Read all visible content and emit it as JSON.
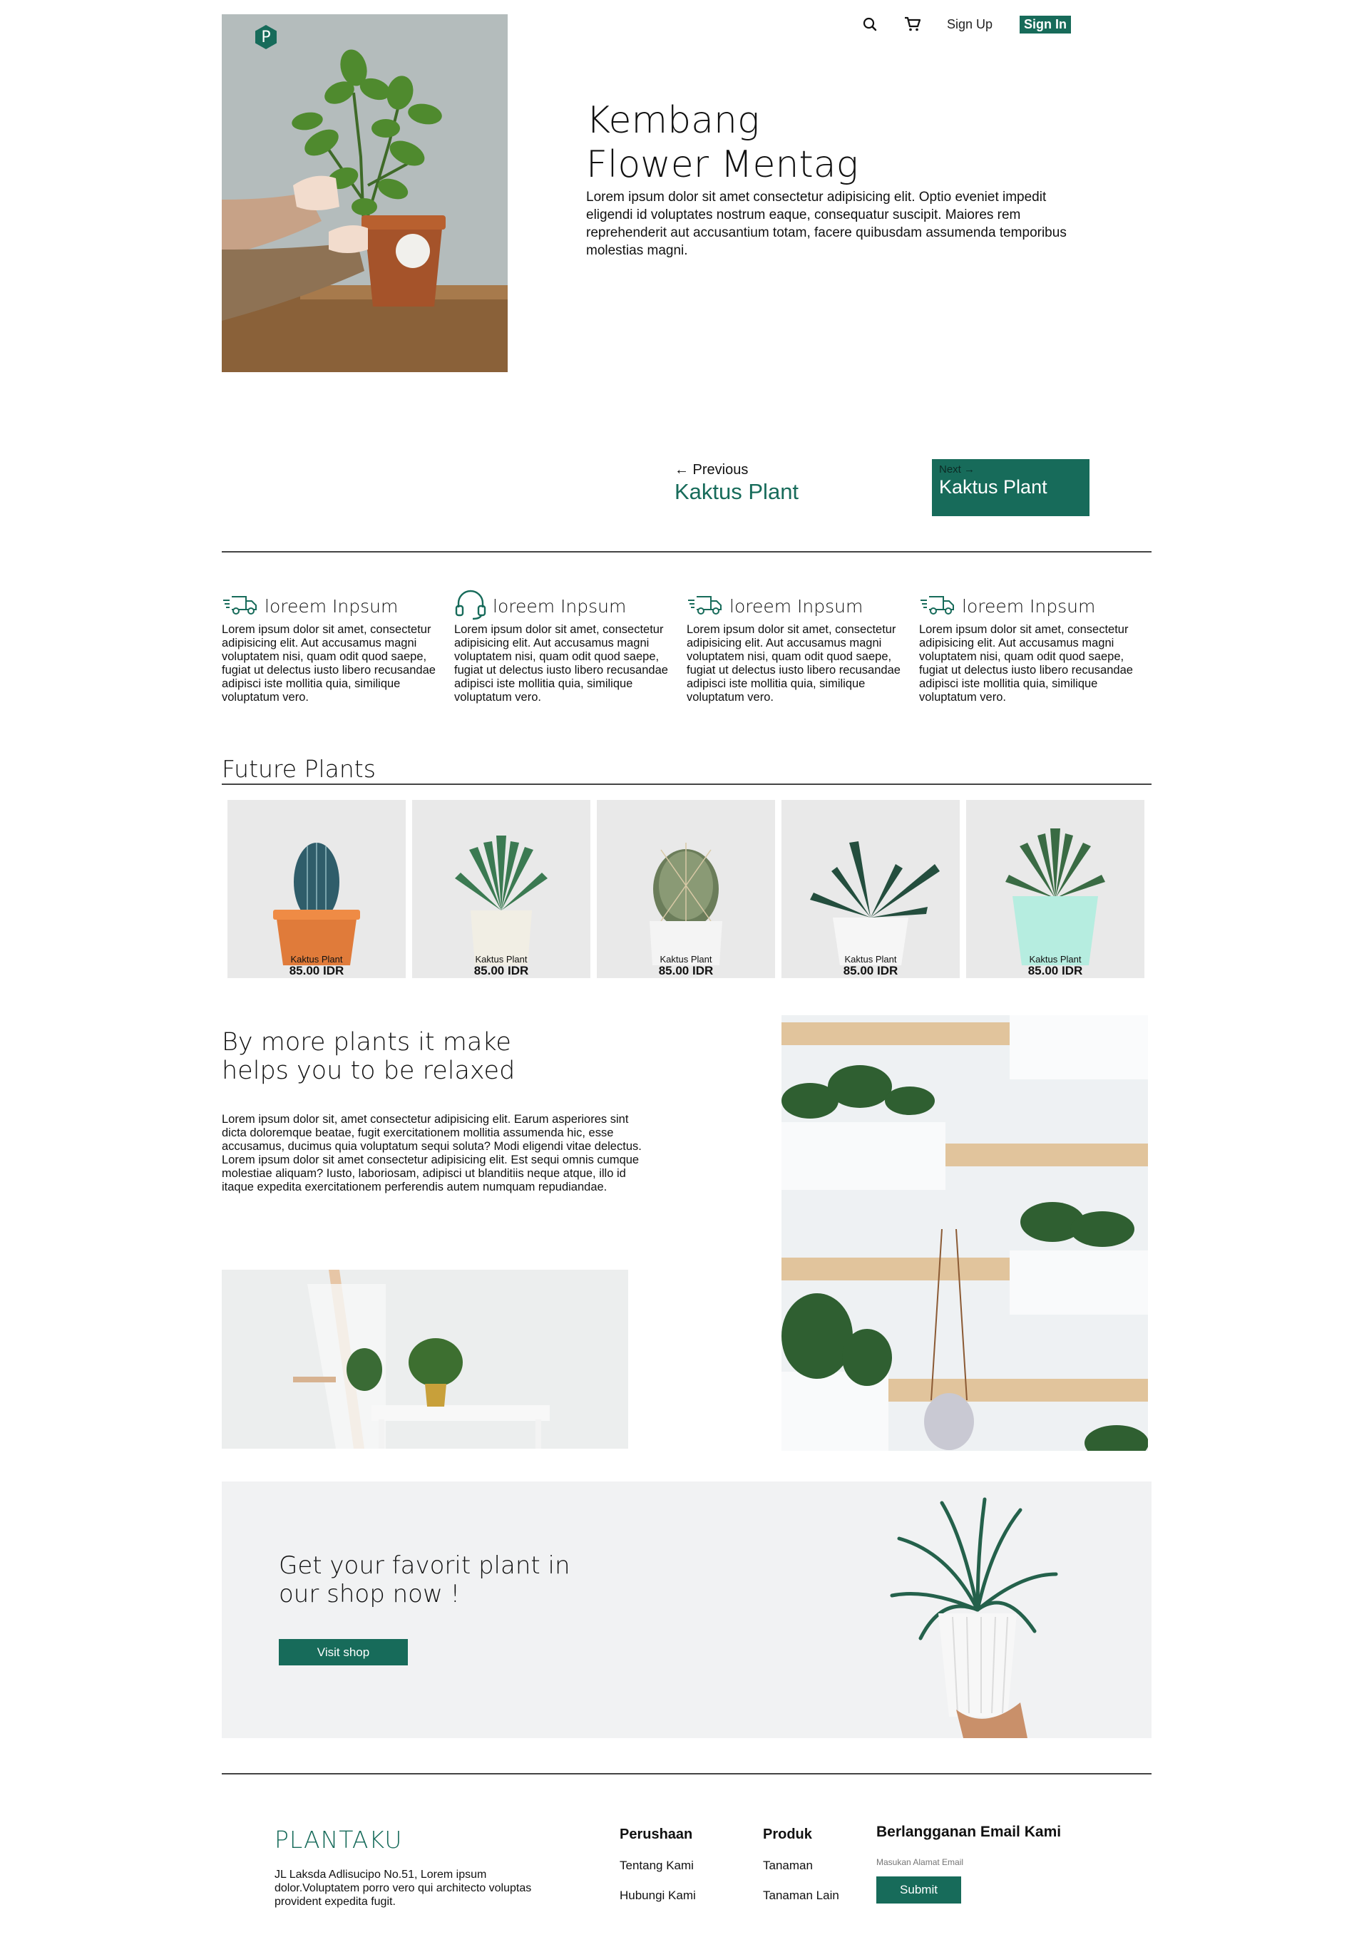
{
  "header": {
    "logo_letter": "P",
    "signup_label": "Sign Up",
    "signin_label": "Sign In"
  },
  "hero": {
    "title_line1": "Kembang",
    "title_line2": "Flower Mentag",
    "description": "Lorem ipsum dolor sit amet consectetur adipisicing elit. Optio eveniet impedit eligendi id voluptates nostrum eaque, consequatur suscipit. Maiores rem reprehenderit aut accusantium totam, facere quibusdam assumenda temporibus molestias magni."
  },
  "pager": {
    "prev_label": "← Previous",
    "prev_name": "Kaktus Plant",
    "next_label": "Next →",
    "next_name": "Kaktus Plant"
  },
  "features": [
    {
      "icon": "truck-icon",
      "title": "loreem Inpsum",
      "text": "Lorem ipsum dolor sit amet, consectetur adipisicing elit. Aut accusamus magni voluptatem nisi, quam odit quod saepe, fugiat ut delectus iusto libero recusandae adipisci iste mollitia quia, similique voluptatum vero."
    },
    {
      "icon": "headset-icon",
      "title": "loreem Inpsum",
      "text": "Lorem ipsum dolor sit amet, consectetur adipisicing elit. Aut accusamus magni voluptatem nisi, quam odit quod saepe, fugiat ut delectus iusto libero recusandae adipisci iste mollitia quia, similique voluptatum vero."
    },
    {
      "icon": "truck-icon",
      "title": "loreem Inpsum",
      "text": "Lorem ipsum dolor sit amet, consectetur adipisicing elit. Aut accusamus magni voluptatem nisi, quam odit quod saepe, fugiat ut delectus iusto libero recusandae adipisci iste mollitia quia, similique voluptatum vero."
    },
    {
      "icon": "truck-icon",
      "title": "loreem Inpsum",
      "text": "Lorem ipsum dolor sit amet, consectetur adipisicing elit. Aut accusamus magni voluptatem nisi, quam odit quod saepe, fugiat ut delectus iusto libero recusandae adipisci iste mollitia quia, similique voluptatum vero."
    }
  ],
  "future_plants": {
    "title": "Future Plants",
    "items": [
      {
        "name": "Kaktus Plant",
        "price": "85.00 IDR"
      },
      {
        "name": "Kaktus Plant",
        "price": "85.00 IDR"
      },
      {
        "name": "Kaktus Plant",
        "price": "85.00 IDR"
      },
      {
        "name": "Kaktus Plant",
        "price": "85.00 IDR"
      },
      {
        "name": "Kaktus Plant",
        "price": "85.00 IDR"
      }
    ]
  },
  "relax": {
    "title_line1": "By more plants it make",
    "title_line2": "helps you to be relaxed",
    "text": "Lorem ipsum dolor sit, amet consectetur adipisicing elit. Earum asperiores sint dicta doloremque beatae, fugit exercitationem mollitia assumenda hic, esse accusamus, ducimus quia voluptatum sequi soluta? Modi eligendi vitae delectus. Lorem ipsum dolor sit amet consectetur adipisicing elit. Est sequi omnis cumque molestiae aliquam? Iusto, laboriosam, adipisci ut blanditiis neque atque, illo id itaque expedita exercitationem perferendis autem numquam repudiandae."
  },
  "cta": {
    "title_line1": "Get your favorit plant in",
    "title_line2": "our shop now !",
    "button": "Visit shop"
  },
  "footer": {
    "brand": "PLANTAKU",
    "address": "JL Laksda Adlisucipo No.51, Lorem ipsum dolor.Voluptatem porro vero qui architecto voluptas provident expedita fugit.",
    "col1": {
      "heading": "Perushaan",
      "links": [
        "Tentang Kami",
        "Hubungi Kami"
      ]
    },
    "col2": {
      "heading": "Produk",
      "links": [
        "Tanaman",
        "Tanaman Lain"
      ]
    },
    "subscribe": {
      "heading": "Berlangganan Email Kami",
      "placeholder": "Masukan Alamat Email",
      "button": "Submit"
    }
  },
  "colors": {
    "accent": "#176b5a",
    "divider": "#444444",
    "panel": "#f1f2f3"
  }
}
